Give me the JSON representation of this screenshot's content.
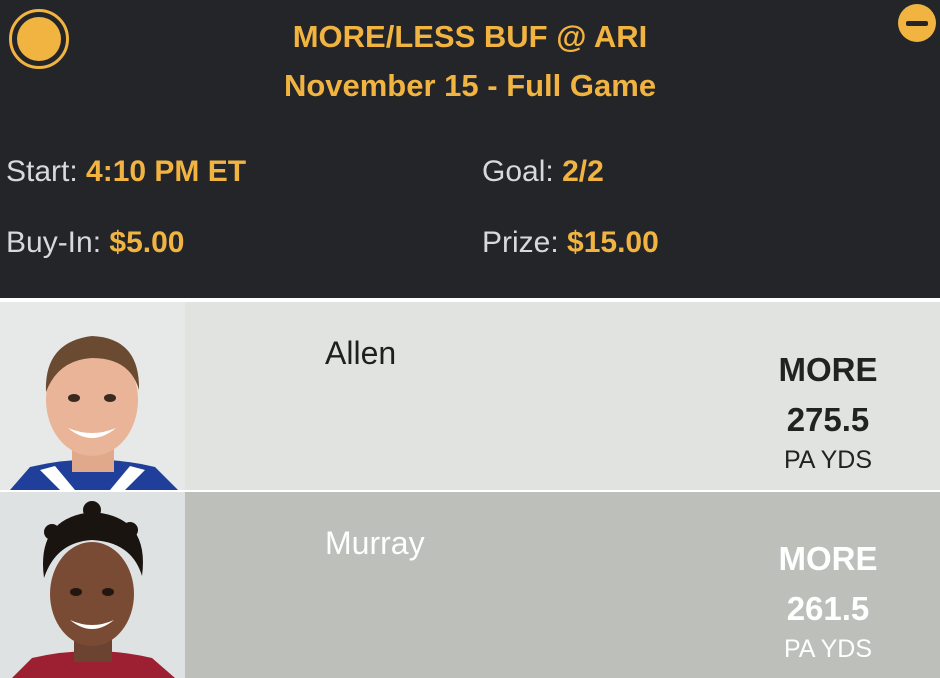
{
  "header": {
    "title": "MORE/LESS BUF @ ARI",
    "subtitle": "November 15 - Full Game",
    "start_label": "Start:",
    "start_value": "4:10 PM ET",
    "goal_label": "Goal:",
    "goal_value": "2/2",
    "buyin_label": "Buy-In:",
    "buyin_value": "$5.00",
    "prize_label": "Prize:",
    "prize_value": "$15.00"
  },
  "players": [
    {
      "name": "Allen",
      "choice": "MORE",
      "line": "275.5",
      "stat": "PA YDS",
      "jersey_color": "#1f3f9a"
    },
    {
      "name": "Murray",
      "choice": "MORE",
      "line": "261.5",
      "stat": "PA YDS",
      "jersey_color": "#9c1f32"
    }
  ],
  "colors": {
    "accent": "#f2b441",
    "header_bg": "#242529",
    "row1_bg": "#e1e3e0",
    "row2_bg": "#bcbfba"
  },
  "icons": {
    "select": "radio-selected-icon",
    "collapse": "minus-circle-icon"
  }
}
